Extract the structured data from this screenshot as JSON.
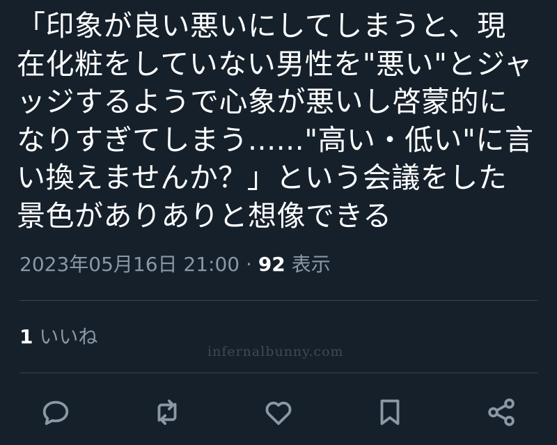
{
  "tweet": {
    "text": "「印象が良い悪いにしてしまうと、現\n在化粧をしていない男性を\"悪い\"とジャ\nッジするようで心象が悪いし啓蒙的に\nなりすぎてしまう......\"高い・低い\"に言\nい換えませんか？」という会議をした\n景色がありありと想像できる",
    "timestamp": "2023年05月16日 21:00",
    "separator": "·",
    "views_count": "92",
    "views_label": "表示"
  },
  "stats": {
    "likes_count": "1",
    "likes_label": "いいね"
  },
  "watermark": "infernalbunny.com",
  "actions": [
    {
      "name": "reply",
      "icon": "speech-bubble-icon"
    },
    {
      "name": "retweet",
      "icon": "retweet-arrows-icon"
    },
    {
      "name": "like",
      "icon": "heart-icon"
    },
    {
      "name": "bookmark",
      "icon": "bookmark-icon"
    },
    {
      "name": "share",
      "icon": "share-icon"
    }
  ],
  "colors": {
    "background": "#15202b",
    "text": "#ffffff",
    "secondary_text": "#8b98a5",
    "divider": "#38444d",
    "icon": "#8b98a5"
  }
}
